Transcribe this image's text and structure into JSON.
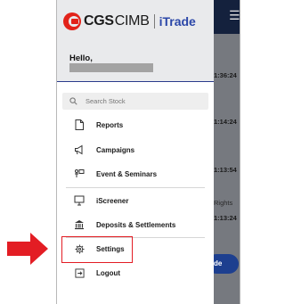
{
  "brand": {
    "cgs": "CGS",
    "cimb": "CIMB",
    "itrade": "iTrade",
    "accent_color": "#2b47a8",
    "logo_red": "#e2231a"
  },
  "drawer": {
    "greeting": "Hello,"
  },
  "search": {
    "placeholder": "Search Stock",
    "icon": "search-icon"
  },
  "menu": {
    "items": [
      {
        "label": "Reports",
        "icon": "document-icon"
      },
      {
        "label": "Campaigns",
        "icon": "megaphone-icon"
      },
      {
        "label": "Event & Seminars",
        "icon": "presentation-icon"
      },
      {
        "label": "iScreener",
        "icon": "screener-icon"
      },
      {
        "label": "Deposits & Settlements",
        "icon": "bank-icon"
      },
      {
        "label": "Settings",
        "icon": "gear-icon"
      },
      {
        "label": "Logout",
        "icon": "logout-icon"
      }
    ]
  },
  "background": {
    "times": [
      "1:36:24",
      "1:14:24",
      "1:13:54",
      "1:13:24"
    ],
    "rights": "Rights",
    "pill": "de",
    "menu_icon": "hamburger-menu-icon"
  },
  "annotation": {
    "highlight_color": "#e31d24",
    "arrow_color": "#e31d24"
  }
}
